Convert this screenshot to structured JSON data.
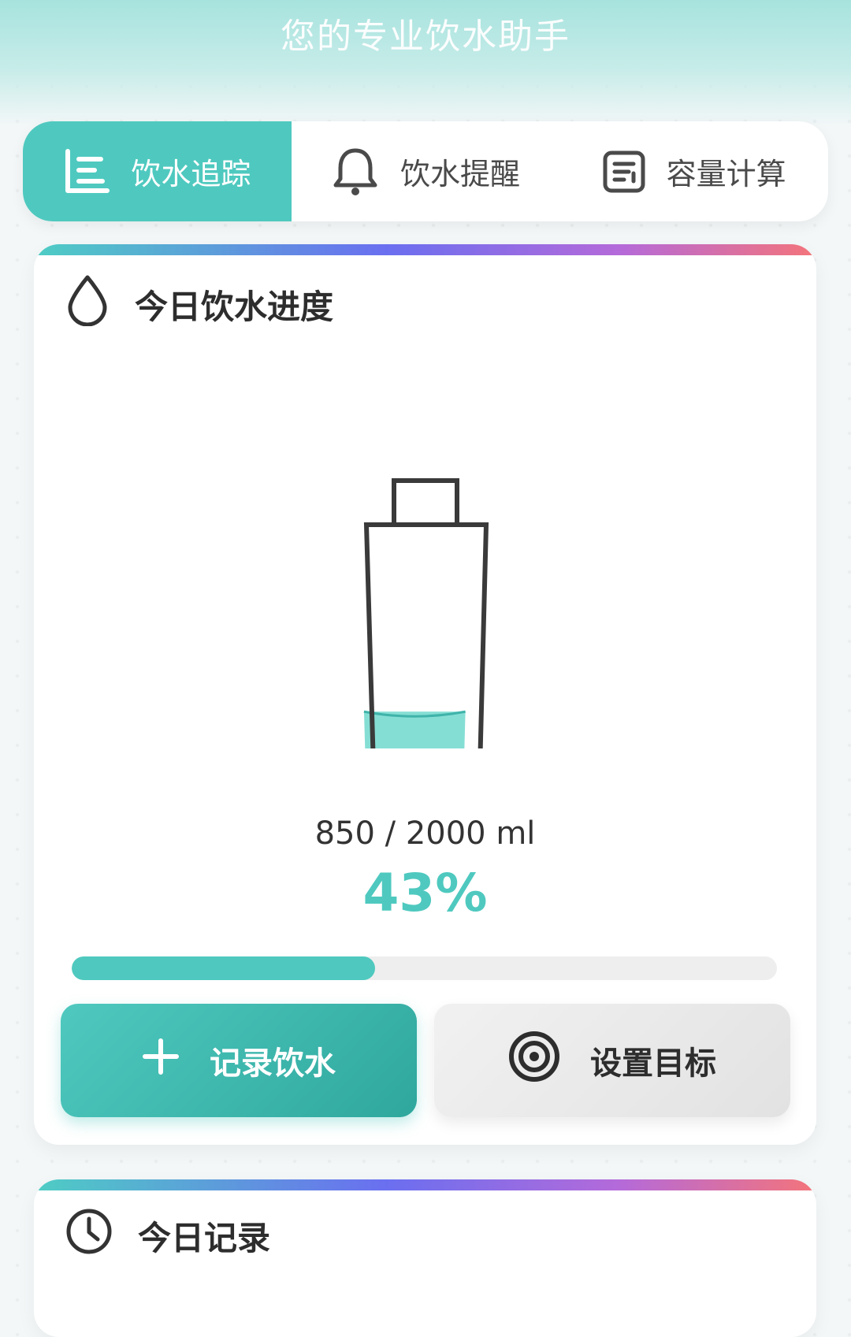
{
  "header": {
    "title": "您的专业饮水助手"
  },
  "tabs": [
    {
      "label": "饮水追踪",
      "icon": "list-chart-icon",
      "active": true
    },
    {
      "label": "饮水提醒",
      "icon": "bell-icon",
      "active": false
    },
    {
      "label": "容量计算",
      "icon": "calculator-icon",
      "active": false
    }
  ],
  "progress_card": {
    "title": "今日饮水进度",
    "icon": "water-drop-icon",
    "amount_text": "850 / 2000 ml",
    "current_ml": 850,
    "goal_ml": 2000,
    "percent_text": "43%",
    "progress_fraction": 0.43,
    "buttons": {
      "record_label": "记录饮水",
      "record_icon": "plus-icon",
      "goal_label": "设置目标",
      "goal_icon": "target-icon"
    }
  },
  "records_card": {
    "title": "今日记录",
    "icon": "clock-icon"
  },
  "colors": {
    "accent": "#4fc9bf",
    "water": "#85ded4",
    "bottle_outline": "#3a3a3a"
  }
}
